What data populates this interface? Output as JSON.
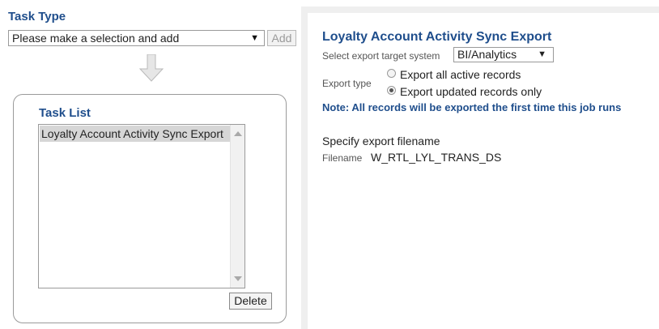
{
  "task_type": {
    "title": "Task Type",
    "select_value": "Please make a selection and add",
    "add_label": "Add"
  },
  "task_list": {
    "title": "Task List",
    "items": [
      "Loyalty Account Activity Sync Export"
    ],
    "delete_label": "Delete"
  },
  "export": {
    "title": "Loyalty Account Activity Sync Export",
    "target_label": "Select export target system",
    "target_value": "BI/Analytics",
    "type_label": "Export type",
    "options": [
      {
        "label": "Export all active records",
        "checked": false
      },
      {
        "label": "Export updated records only",
        "checked": true
      }
    ],
    "note": "Note: All records will be exported the first time this job runs",
    "specify_label": "Specify export filename",
    "filename_label": "Filename",
    "filename_value": "W_RTL_LYL_TRANS_DS"
  },
  "colors": {
    "accent": "#1f4e8c",
    "panel_bg": "#efefef",
    "selected_item": "#d6d6d6"
  }
}
